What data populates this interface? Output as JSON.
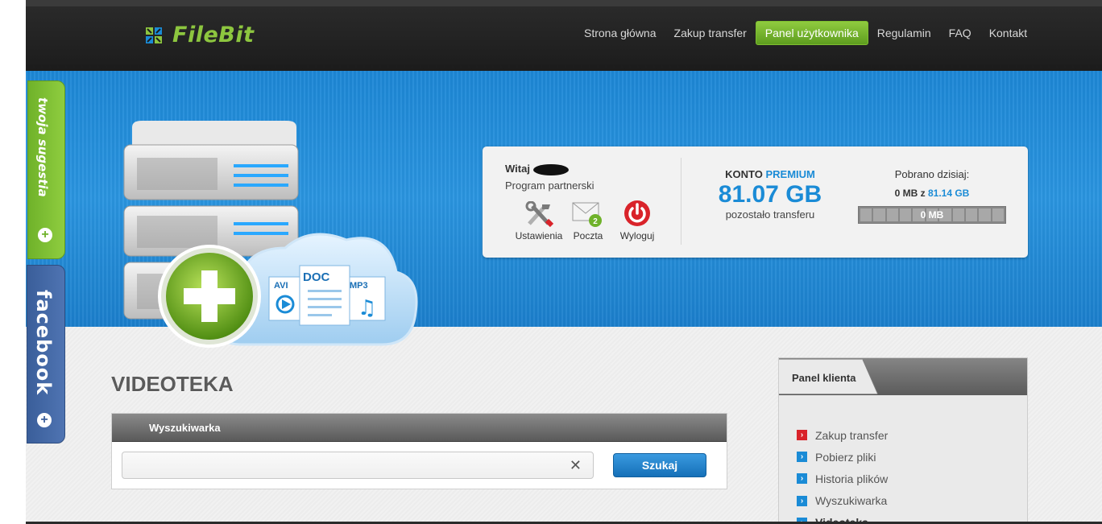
{
  "brand": {
    "name_part1": "File",
    "name_part2": "Bit",
    "accent": "#8dc63f"
  },
  "nav": {
    "items": [
      {
        "label": "Strona główna",
        "active": false
      },
      {
        "label": "Zakup transfer",
        "active": false
      },
      {
        "label": "Panel użytkownika",
        "active": true
      },
      {
        "label": "Regulamin",
        "active": false
      },
      {
        "label": "FAQ",
        "active": false
      },
      {
        "label": "Kontakt",
        "active": false
      }
    ]
  },
  "side_tabs": {
    "suggest_label": "twoja sugestia",
    "facebook_label": "facebook",
    "plus": "+"
  },
  "hero": {
    "file_labels": [
      "AVI",
      "DOC",
      "MP3"
    ]
  },
  "account": {
    "greeting": "Witaj",
    "partner_label": "Program partnerski",
    "actions": [
      {
        "label": "Ustawienia",
        "icon": "tools-icon"
      },
      {
        "label": "Poczta",
        "icon": "mail-icon",
        "badge": "2"
      },
      {
        "label": "Wyloguj",
        "icon": "power-icon"
      }
    ],
    "konto_prefix": "KONTO",
    "konto_type": "PREMIUM",
    "transfer_left": "81.07 GB",
    "transfer_left_label": "pozostało transferu",
    "downloaded_title": "Pobrano dzisiaj:",
    "downloaded_amount": "0 MB",
    "downloaded_of": "z",
    "downloaded_limit": "81.14 GB",
    "progress_label": "0 MB",
    "progress_fraction": 0
  },
  "main": {
    "title": "VIDEOTEKA",
    "search": {
      "header": "Wyszukiwarka",
      "value": "",
      "button_label": "Szukaj",
      "clear_glyph": "✕"
    }
  },
  "client_panel": {
    "title": "Panel klienta",
    "items": [
      {
        "label": "Zakup transfer",
        "color": "#d9232a",
        "active": false
      },
      {
        "label": "Pobierz pliki",
        "color": "#1a8bd6",
        "active": false
      },
      {
        "label": "Historia plików",
        "color": "#1a8bd6",
        "active": false
      },
      {
        "label": "Wyszukiwarka",
        "color": "#1a8bd6",
        "active": false
      },
      {
        "label": "Videoteka",
        "color": "#1a8bd6",
        "active": true
      }
    ]
  }
}
